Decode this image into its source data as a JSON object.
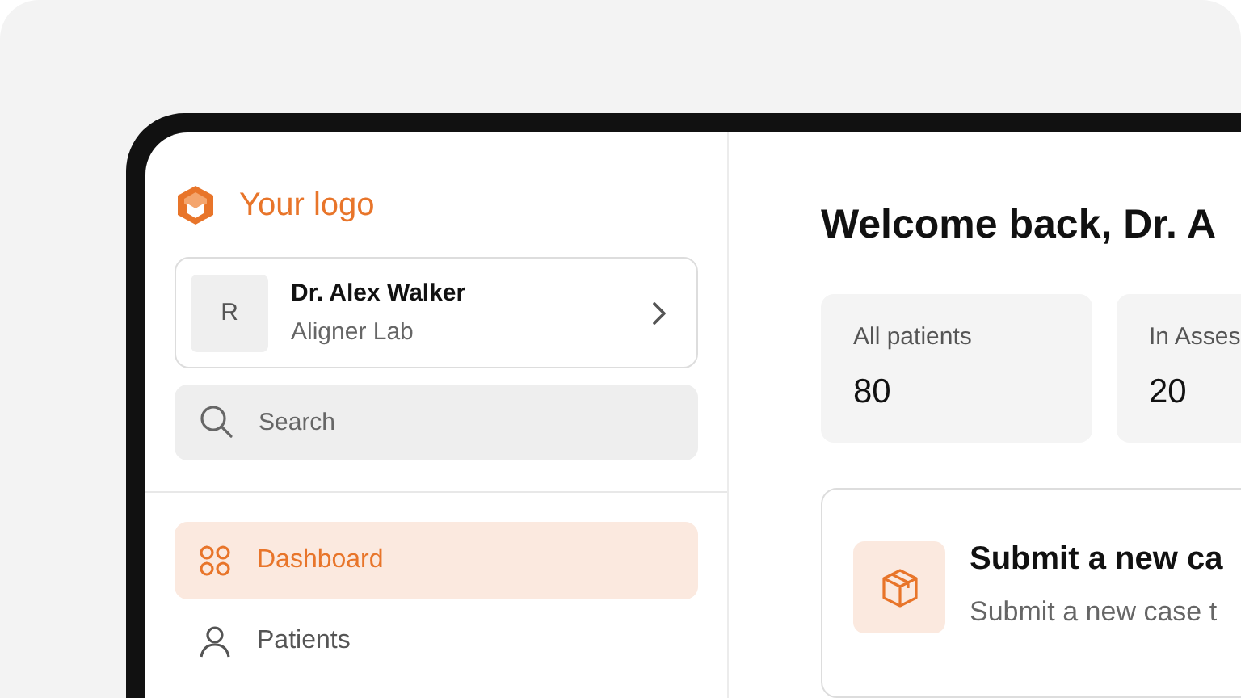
{
  "logo": {
    "text": "Your logo"
  },
  "profile": {
    "avatar": "R",
    "name": "Dr. Alex Walker",
    "org": "Aligner Lab"
  },
  "search": {
    "placeholder": "Search"
  },
  "nav": [
    {
      "label": "Dashboard",
      "kind": "grid",
      "selected": true
    },
    {
      "label": "Patients",
      "kind": "user",
      "selected": false
    }
  ],
  "heading": "Welcome back, Dr. A",
  "stats": [
    {
      "label": "All patients",
      "value": "80"
    },
    {
      "label": "In Asses",
      "value": "20"
    }
  ],
  "action_card": {
    "title": "Submit a new ca",
    "description": "Submit a new case t"
  }
}
